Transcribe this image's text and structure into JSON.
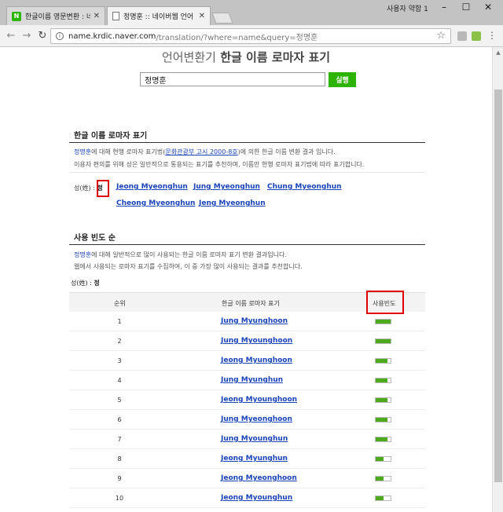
{
  "browser": {
    "tabs": [
      {
        "title": "한글이름 영문변환 : 네이",
        "active": false,
        "icon": "naver-icon"
      },
      {
        "title": "정명훈 :: 네이버웹 언어",
        "active": true,
        "icon": "page-icon"
      }
    ],
    "profile_name": "사용자 약함 1",
    "url_host": "name.krdic.naver.com",
    "url_rest": "/translation/?where=name&query=정명훈",
    "colors": {
      "naver_green": "#2db400",
      "link_blue": "#1a44b8",
      "highlight_red": "#e00000"
    }
  },
  "page": {
    "heading_light": "언어변환기",
    "heading_bold": "한글 이름 로마자 표기",
    "search": {
      "value": "정명훈",
      "button_label": "실행"
    },
    "section1": {
      "title": "한글 이름 로마자 표기",
      "desc1_name": "정명훈",
      "desc1_a": "에 대해 현행 로마자 표기법(",
      "desc1_link": "문화관광부 고시 2000-8호",
      "desc1_b": ")에 의한 한글 이름 변환 결과 입니다.",
      "desc2": "이용자 편의를 위해 성은 일반적으로 통용되는 표기를 추천하며, 이름만 현행 로마자 표기법에 따라 표기합니다.",
      "surname_label": "성(姓) : ",
      "surname": "정",
      "romanizations": [
        "Jeong Myeonghun",
        "Jung Myeonghun",
        "Chung Myeonghun",
        "Cheong Myeonghun",
        "Jeng Myeonghun"
      ]
    },
    "section2": {
      "title": "사용 빈도 순",
      "desc1_name": "정명훈",
      "desc1": "에 대해 일반적으로 많이 사용되는 한글 이름 로마자 표기 변환 결과입니다.",
      "desc2": "웹에서 사용되는 로마자 표기를 수집하여, 이 중 가장 많이 사용되는 결과를 추천합니다.",
      "surname_label": "성(姓) : ",
      "surname": "정",
      "columns": [
        "순위",
        "한글 이름 로마자 표기",
        "사용빈도"
      ],
      "rows": [
        {
          "rank": "1",
          "roman": "Jung Myunghoon",
          "freq": 1.0
        },
        {
          "rank": "2",
          "roman": "Jung Myounghoon",
          "freq": 1.0
        },
        {
          "rank": "3",
          "roman": "Jeong Myunghoon",
          "freq": 0.8
        },
        {
          "rank": "4",
          "roman": "Jung Myunghun",
          "freq": 0.8
        },
        {
          "rank": "5",
          "roman": "Jeong Myounghoon",
          "freq": 0.8
        },
        {
          "rank": "6",
          "roman": "Jung Myeonghoon",
          "freq": 0.8
        },
        {
          "rank": "7",
          "roman": "Jung Myounghun",
          "freq": 0.8
        },
        {
          "rank": "8",
          "roman": "Jeong Myunghun",
          "freq": 0.55
        },
        {
          "rank": "9",
          "roman": "Jeong Myeonghoon",
          "freq": 0.55
        },
        {
          "rank": "10",
          "roman": "Jeong Myounghun",
          "freq": 0.55
        }
      ]
    }
  }
}
